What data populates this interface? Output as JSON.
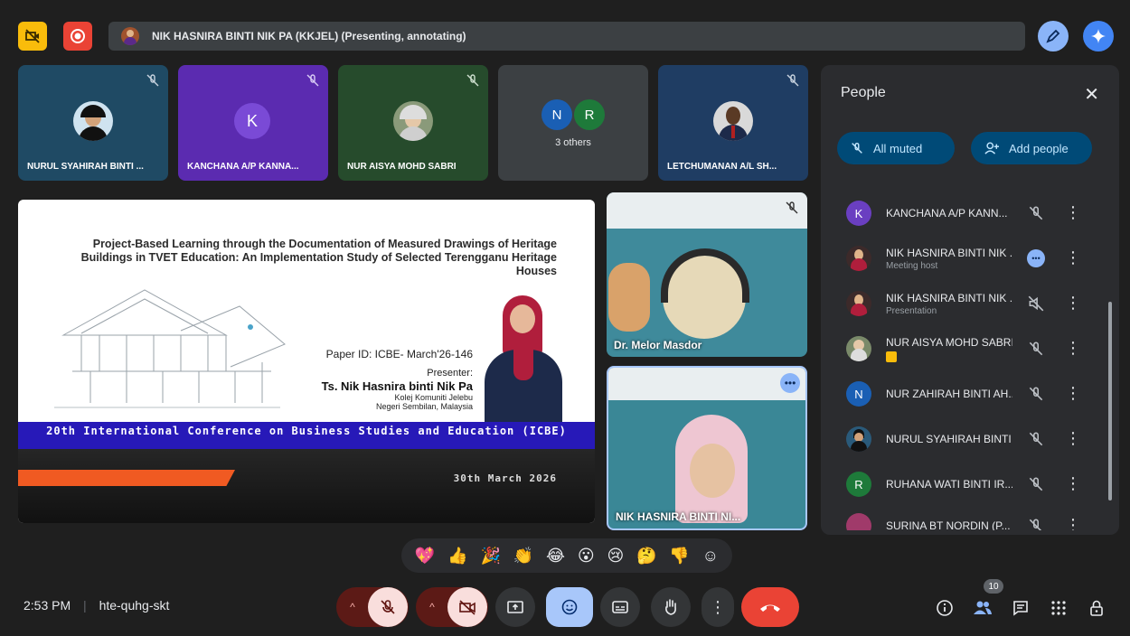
{
  "topbar": {
    "presenter_text": "NIK HASNIRA BINTI NIK PA (KKJEL) (Presenting, annotating)",
    "colors": {
      "yellow_btn": "#f9bc0b",
      "red_btn": "#ea4335",
      "pen_btn": "#8ab4f8",
      "ai_btn": "#4285f4"
    }
  },
  "tiles": [
    {
      "name": "NURUL SYAHIRAH BINTI ...",
      "bg": "#1f4a64",
      "avatar": "photo"
    },
    {
      "name": "KANCHANA A/P KANNA...",
      "bg": "#5b2bb0",
      "avatar": "letter",
      "letter": "K"
    },
    {
      "name": "NUR AISYA MOHD SABRI",
      "bg": "#264b2c",
      "avatar": "photo"
    },
    {
      "name": "3 others",
      "bg": "#3c4043",
      "letters": [
        "N",
        "R"
      ]
    },
    {
      "name": "LETCHUMANAN A/L SH...",
      "bg": "#1f3d63",
      "avatar": "photo"
    }
  ],
  "slide": {
    "title": "Project-Based Learning through the Documentation of Measured Drawings of Heritage Buildings in TVET Education: An Implementation Study of Selected Terengganu Heritage Houses",
    "paper_id": "Paper ID: ICBE- March'26-146",
    "presenter_label": "Presenter:",
    "presenter_name": "Ts. Nik Hasnira binti Nik Pa",
    "college_line1": "Kolej Komuniti Jelebu",
    "college_line2": "Negeri Sembilan, Malaysia",
    "conference": "20th International Conference on Business Studies and Education (ICBE)",
    "date": "30th March 2026"
  },
  "video_tiles": [
    {
      "caption": "Dr. Melor Masdor"
    },
    {
      "caption": "NIK HASNIRA BINTI NI..."
    }
  ],
  "people_panel": {
    "title": "People",
    "all_muted": "All muted",
    "add_people": "Add people",
    "participants": [
      {
        "name": "KANCHANA A/P KANN...",
        "sub": "",
        "letter": "K",
        "color": "#6a3fc1",
        "mic": "off"
      },
      {
        "name": "NIK HASNIRA BINTI NIK ...",
        "sub": "Meeting host",
        "letter": "",
        "color": "#a0522d",
        "mic": "speaking"
      },
      {
        "name": "NIK HASNIRA BINTI NIK ...",
        "sub": "Presentation",
        "letter": "",
        "color": "#a0522d",
        "mic": "present"
      },
      {
        "name": "NUR AISYA MOHD SABRI",
        "sub": "",
        "letter": "",
        "color": "#7a8a6a",
        "mic": "off"
      },
      {
        "name": "NUR ZAHIRAH BINTI AH...",
        "sub": "",
        "letter": "N",
        "color": "#1a5fb4",
        "mic": "off"
      },
      {
        "name": "NURUL SYAHIRAH BINTI ...",
        "sub": "",
        "letter": "",
        "color": "#2a5a7a",
        "mic": "off"
      },
      {
        "name": "RUHANA WATI BINTI IR...",
        "sub": "",
        "letter": "R",
        "color": "#1e7a3a",
        "mic": "off"
      },
      {
        "name": "SURINA BT NORDIN (P...",
        "sub": "",
        "letter": "",
        "color": "#a03a6a",
        "mic": "off"
      }
    ]
  },
  "reactions": [
    "💖",
    "👍",
    "🎉",
    "👏",
    "😂",
    "😮",
    "😢",
    "🤔",
    "👎",
    "☺"
  ],
  "bottom": {
    "time": "2:53 PM",
    "meeting_code": "hte-quhg-skt",
    "participant_count": "10"
  }
}
